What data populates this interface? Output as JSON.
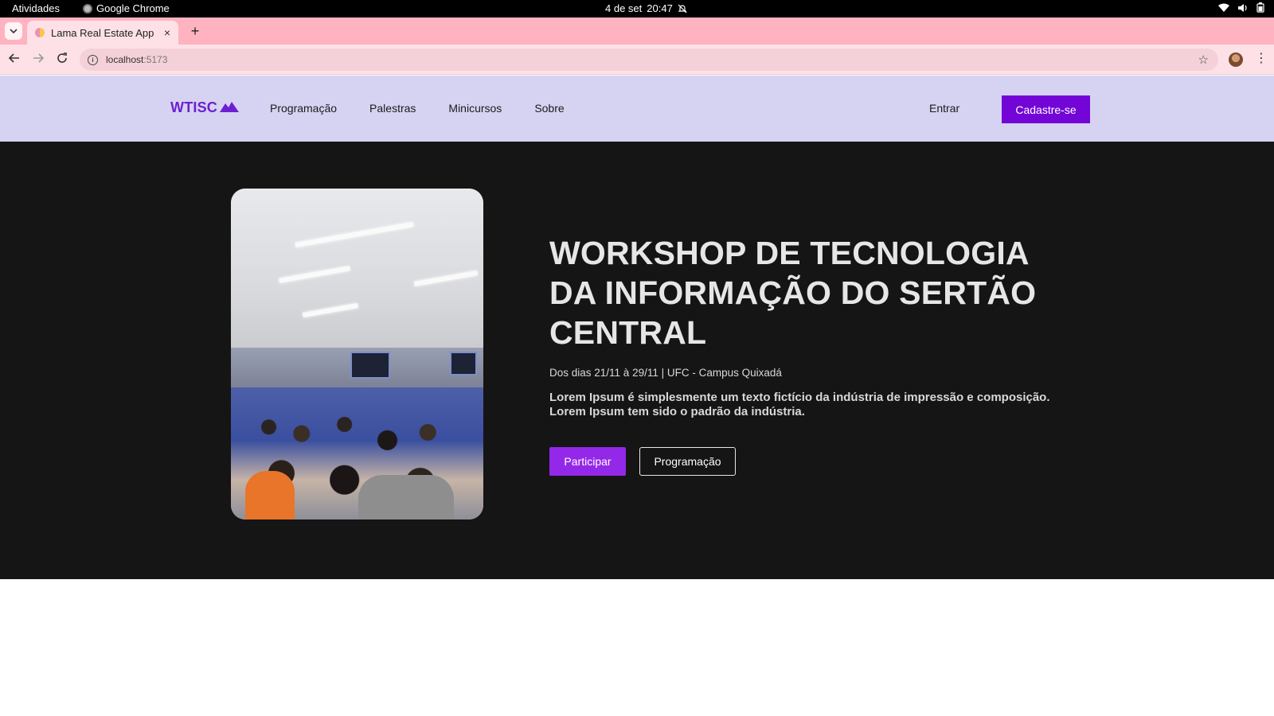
{
  "os_bar": {
    "activities": "Atividades",
    "app_name": "Google Chrome",
    "date": "4 de set",
    "time": "20:47"
  },
  "browser": {
    "tab_title": "Lama Real Estate App",
    "tab_close": "×",
    "new_tab": "+",
    "url_host": "localhost",
    "url_port": ":5173"
  },
  "site": {
    "logo_text": "WTISC",
    "nav": [
      "Programação",
      "Palestras",
      "Minicursos",
      "Sobre"
    ],
    "login_label": "Entrar",
    "signup_label": "Cadastre-se"
  },
  "hero": {
    "title_lines": [
      "WORKSHOP DE TECNOLOGIA",
      "DA INFORMAÇÃO DO SERTÃO",
      "CENTRAL"
    ],
    "date_line": "Dos dias 21/11 à 29/11 | UFC - Campus Quixadá",
    "description_lines": [
      "Lorem Ipsum é simplesmente um texto fictício da indústria de impressão e composição.",
      "Lorem Ipsum tem sido o padrão da indústria."
    ],
    "primary_button": "Participar",
    "secondary_button": "Programação"
  },
  "colors": {
    "tabstrip": "#ffb3c1",
    "site_header": "#d5d3f1",
    "brand_purple": "#7306d6",
    "hero_background": "#151515",
    "primary_button": "#9428e8"
  },
  "icons": {
    "chrome": "chrome-icon",
    "notifications_off": "bell-off-icon",
    "wifi": "wifi-icon",
    "volume": "volume-icon",
    "battery": "battery-icon",
    "back": "arrow-left-icon",
    "forward": "arrow-right-icon",
    "reload": "reload-icon",
    "site_info": "info-icon",
    "bookmark": "star-icon",
    "menu": "kebab-menu-icon",
    "logo_mark": "mountain-icon"
  }
}
